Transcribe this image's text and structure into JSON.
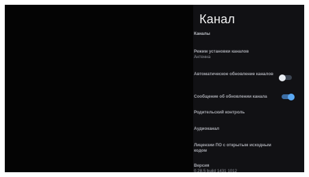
{
  "panel": {
    "title": "Канал",
    "items": [
      {
        "label": "Каналы"
      },
      {
        "label": "Режим установки каналов",
        "sub": "Антенна"
      },
      {
        "label": "Автоматическое обновление каналов",
        "toggle": "off"
      },
      {
        "label": "Сообщение об обновлении канала",
        "toggle": "on"
      },
      {
        "label": "Родительский контроль"
      },
      {
        "label": "Аудиоканал"
      },
      {
        "label": "Лицензии ПО с открытым исходным кодом"
      },
      {
        "label": "Версия",
        "sub": "0.28.5 build 1431 1012"
      }
    ]
  },
  "colors": {
    "background": "#040404",
    "panel": "#111114",
    "toggle_on": "#5aa8f2",
    "toggle_off": "#e9edf2"
  }
}
